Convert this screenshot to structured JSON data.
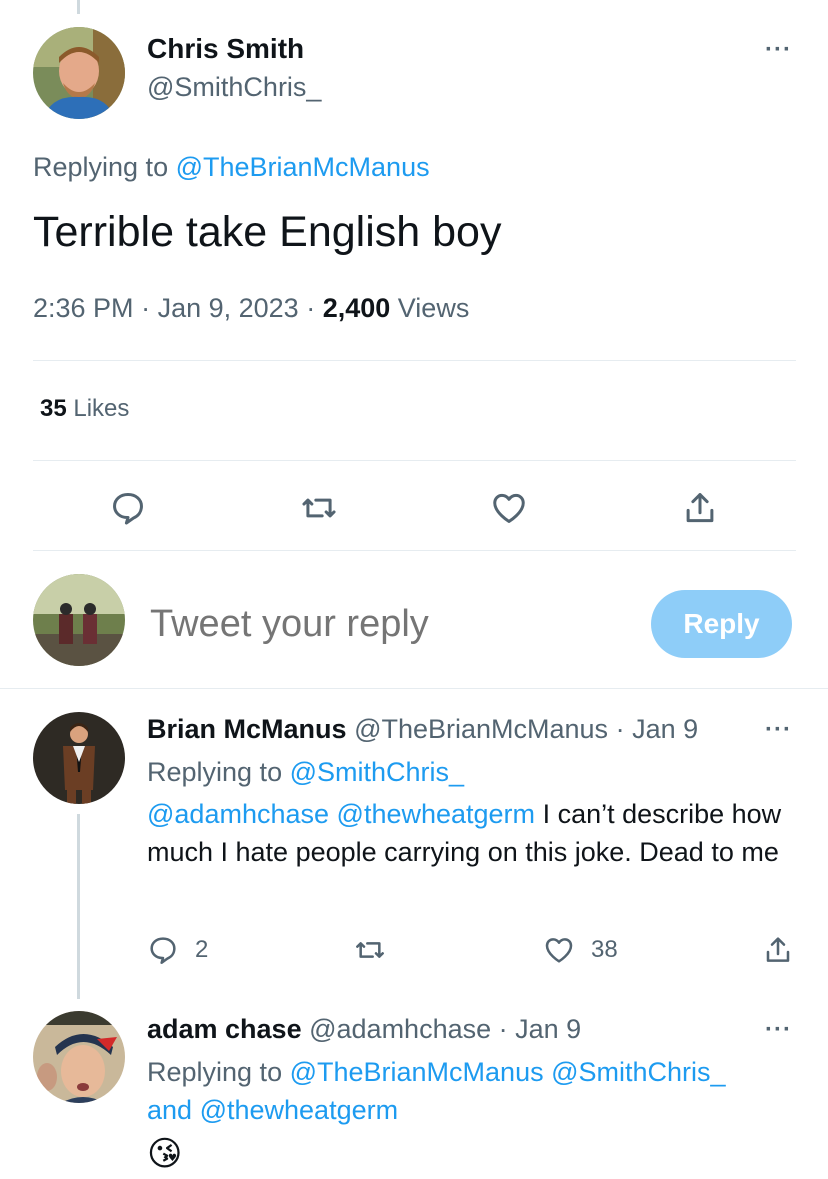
{
  "main_tweet": {
    "author_name": "Chris Smith",
    "author_handle": "@SmithChris_",
    "replying_prefix": "Replying to ",
    "replying_to": "@TheBrianMcManus",
    "text": "Terrible take English boy",
    "time": "2:36 PM",
    "date": "Jan 9, 2023",
    "views_count": "2,400",
    "views_label": "Views",
    "likes_count": "35",
    "likes_label": "Likes",
    "more": "···"
  },
  "actions": [
    "reply-icon",
    "retweet-icon",
    "like-icon",
    "share-icon"
  ],
  "composer": {
    "placeholder": "Tweet your reply",
    "button_label": "Reply"
  },
  "replies": [
    {
      "author_name": "Brian McManus",
      "author_handle": "@TheBrianMcManus",
      "date": "Jan 9",
      "replying_prefix": "Replying to ",
      "replying_to": "@SmithChris_",
      "mentions": [
        "@adamhchase",
        "@thewheatgerm"
      ],
      "text": "I can’t describe how much I hate people carrying on this joke. Dead to me",
      "reply_count": "2",
      "like_count": "38",
      "more": "···"
    },
    {
      "author_name": "adam chase",
      "author_handle": "@adamhchase",
      "date": "Jan 9",
      "replying_prefix": "Replying to ",
      "replying_to_1": "@TheBrianMcManus",
      "replying_to_2": "@SmithChris_",
      "replying_and": "and",
      "replying_to_3": "@thewheatgerm",
      "emoji": "😘",
      "more": "···"
    }
  ],
  "colors": {
    "link": "#1d9bf0",
    "secondary_text": "#536471",
    "reply_button": "#8ecdf8"
  }
}
